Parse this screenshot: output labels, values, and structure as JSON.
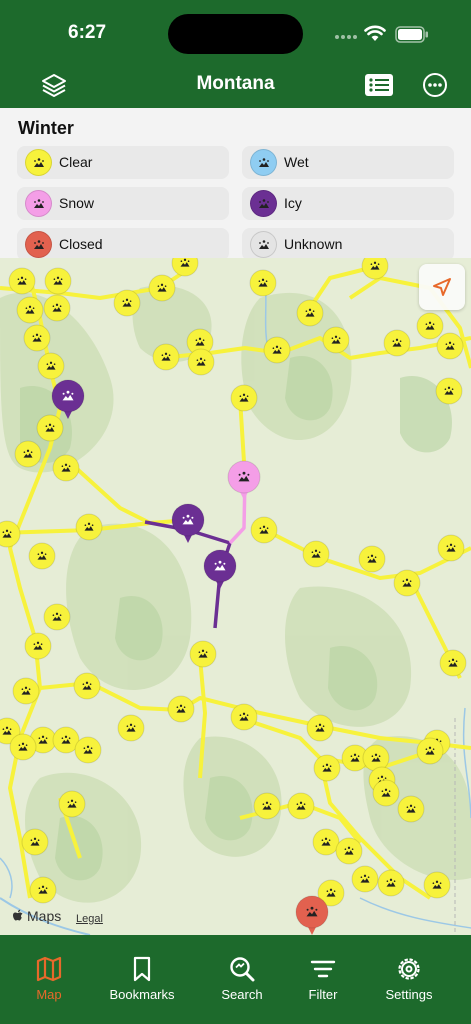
{
  "status": {
    "time": "6:27"
  },
  "nav": {
    "title": "Montana",
    "layers_icon": "layers-icon",
    "list_icon": "list-icon",
    "more_icon": "more-icon"
  },
  "legend": {
    "title": "Winter",
    "items": [
      {
        "label": "Clear",
        "color": "#f7f23c"
      },
      {
        "label": "Wet",
        "color": "#8fcdf2"
      },
      {
        "label": "Snow",
        "color": "#f49ee7"
      },
      {
        "label": "Icy",
        "color": "#6b2f93"
      },
      {
        "label": "Closed",
        "color": "#e2614f"
      },
      {
        "label": "Unknown",
        "color": "#e4e4e4"
      }
    ]
  },
  "map": {
    "attribution": "Maps",
    "legal": "Legal",
    "colors": {
      "clear": "#f7f23c",
      "icy": "#6b2f93",
      "snow": "#f49ee7",
      "closed": "#e2614f"
    }
  },
  "tabs": [
    {
      "label": "Map",
      "icon": "map-icon",
      "active": true
    },
    {
      "label": "Bookmarks",
      "icon": "bookmark-icon",
      "active": false
    },
    {
      "label": "Search",
      "icon": "search-icon",
      "active": false
    },
    {
      "label": "Filter",
      "icon": "filter-icon",
      "active": false
    },
    {
      "label": "Settings",
      "icon": "settings-icon",
      "active": false
    }
  ]
}
